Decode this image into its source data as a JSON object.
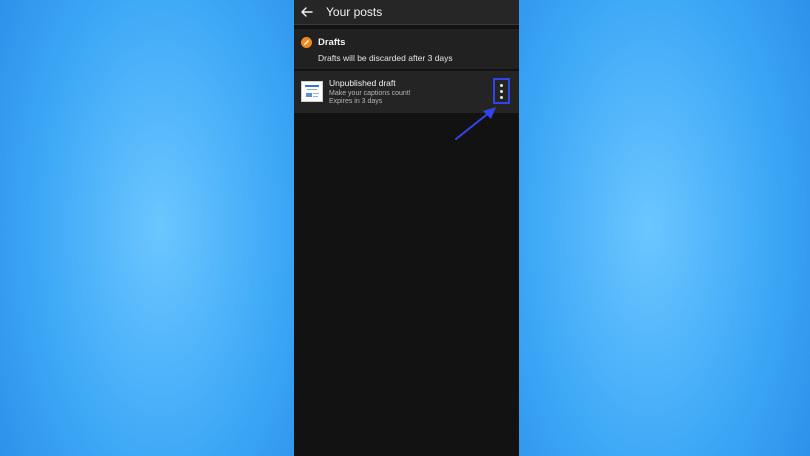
{
  "appbar": {
    "title": "Your posts",
    "back_icon": "arrow-left-icon"
  },
  "drafts": {
    "title": "Drafts",
    "subtitle": "Drafts will be discarded after 3 days",
    "icon": "pencil-icon",
    "icon_color": "#f08a1c"
  },
  "draft_item": {
    "title": "Unpublished draft",
    "caption": "Make your captions count!",
    "expiry": "Expires in 3 days",
    "more_icon": "more-vertical-icon"
  },
  "colors": {
    "highlight": "#2f45e8",
    "phone_bg": "#121212",
    "background": "#3ea9f7"
  }
}
